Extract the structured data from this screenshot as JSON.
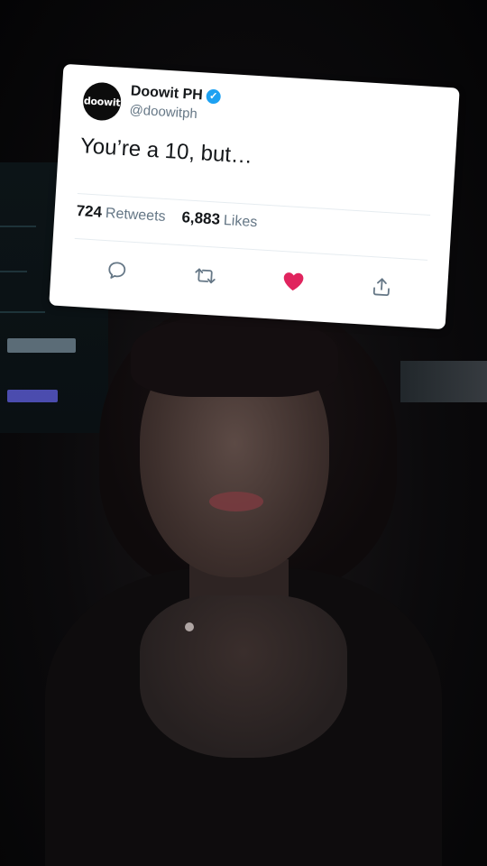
{
  "tweet": {
    "avatar_text": "doowit",
    "display_name": "Doowit PH",
    "handle": "@doowitph",
    "text": "You’re a 10, but…",
    "retweets_count": "724",
    "retweets_label": "Retweets",
    "likes_count": "6,883",
    "likes_label": "Likes",
    "verified": true,
    "liked": true
  },
  "actions": {
    "reply_icon": "reply-icon",
    "retweet_icon": "retweet-icon",
    "like_icon": "heart-icon",
    "share_icon": "share-icon"
  },
  "colors": {
    "card_bg": "#ffffff",
    "text_primary": "#14171a",
    "text_secondary": "#657786",
    "verified_blue": "#1da1f2",
    "like_red": "#e0245e"
  }
}
